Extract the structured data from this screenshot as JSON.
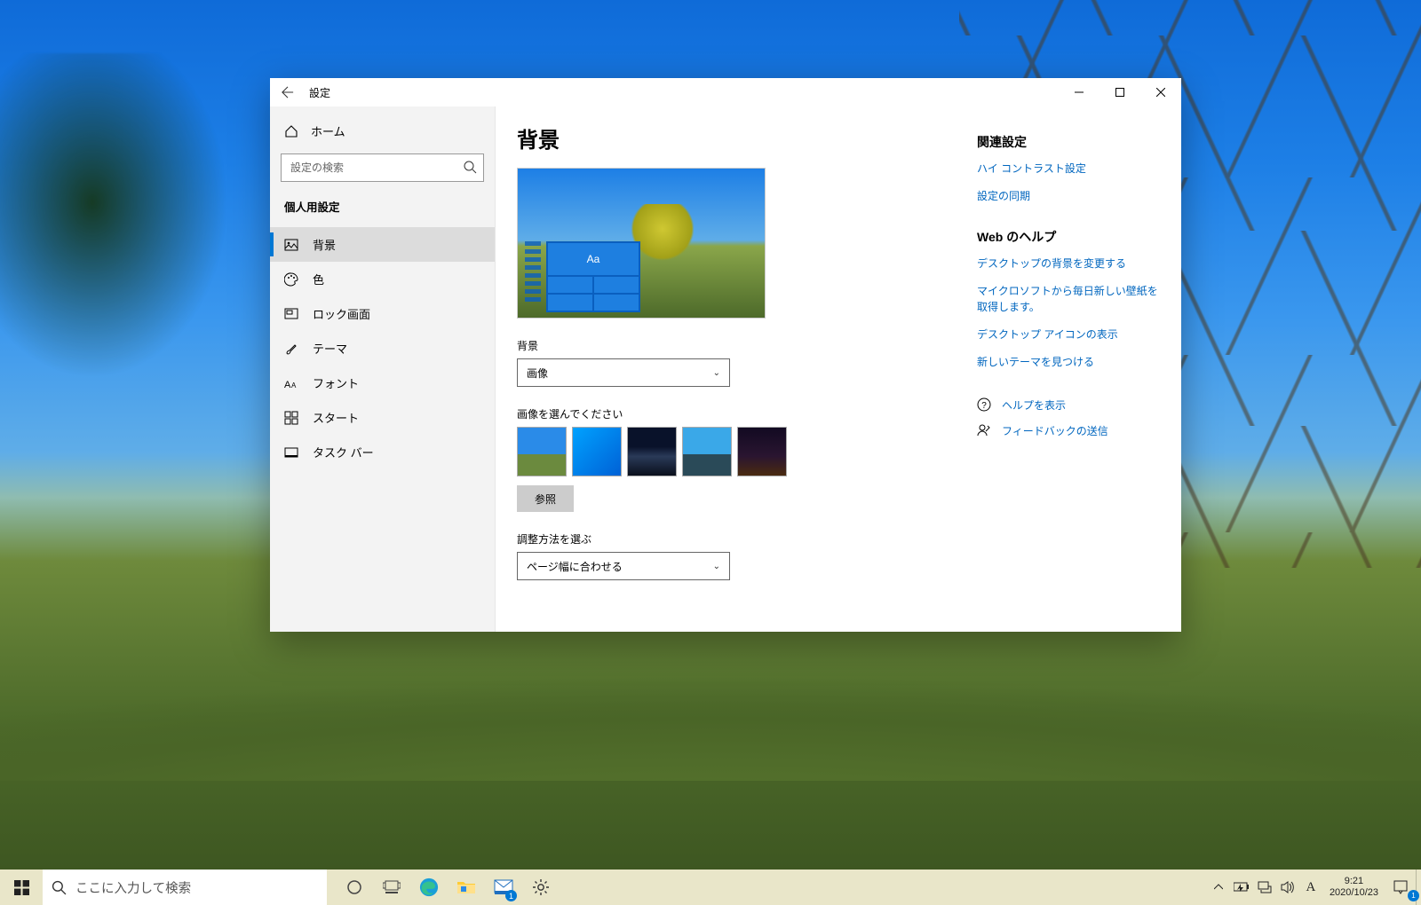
{
  "window": {
    "title": "設定",
    "sidebar": {
      "home": "ホーム",
      "search_placeholder": "設定の検索",
      "section": "個人用設定",
      "items": [
        {
          "id": "background",
          "label": "背景"
        },
        {
          "id": "colors",
          "label": "色"
        },
        {
          "id": "lockscreen",
          "label": "ロック画面"
        },
        {
          "id": "themes",
          "label": "テーマ"
        },
        {
          "id": "fonts",
          "label": "フォント"
        },
        {
          "id": "start",
          "label": "スタート"
        },
        {
          "id": "taskbar",
          "label": "タスク バー"
        }
      ],
      "selected": "background"
    },
    "content": {
      "heading": "背景",
      "preview_tile_text": "Aa",
      "bg_label": "背景",
      "bg_select_value": "画像",
      "choose_label": "画像を選んでください",
      "browse": "参照",
      "fit_label": "調整方法を選ぶ",
      "fit_select_value": "ページ幅に合わせる"
    },
    "rightpane": {
      "related_head": "関連設定",
      "related_links": [
        "ハイ コントラスト設定",
        "設定の同期"
      ],
      "webhelp_head": "Web のヘルプ",
      "webhelp_links": [
        "デスクトップの背景を変更する",
        "マイクロソフトから毎日新しい壁紙を取得します。",
        "デスクトップ アイコンの表示",
        "新しいテーマを見つける"
      ],
      "help": "ヘルプを表示",
      "feedback": "フィードバックの送信"
    }
  },
  "taskbar": {
    "search_placeholder": "ここに入力して検索",
    "ime": "A",
    "time": "9:21",
    "date": "2020/10/23",
    "mail_badge": "1"
  }
}
